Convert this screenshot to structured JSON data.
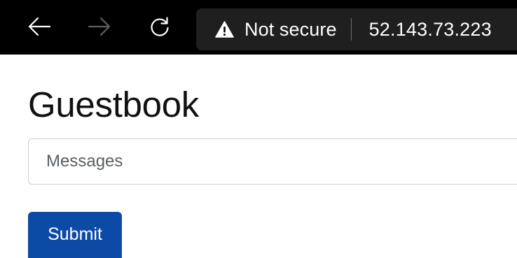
{
  "browser": {
    "back_icon": "arrow-left-icon",
    "forward_icon": "arrow-right-icon",
    "reload_icon": "reload-icon",
    "security_icon": "warning-triangle-icon",
    "security_label": "Not secure",
    "url": "52.143.73.223"
  },
  "page": {
    "title": "Guestbook",
    "message_placeholder": "Messages",
    "message_value": "",
    "submit_label": "Submit"
  },
  "colors": {
    "toolbar_background": "#000000",
    "omnibox_background": "#1f1f1f",
    "submit_button": "#0d4aa6",
    "forward_disabled": "#5f5f5f"
  }
}
